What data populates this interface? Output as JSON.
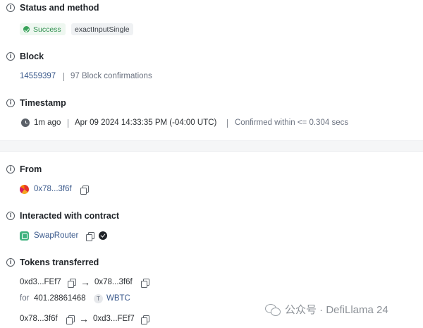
{
  "status_section": {
    "label": "Status and method",
    "status": "Success",
    "method": "exactInputSingle"
  },
  "block_section": {
    "label": "Block",
    "number": "14559397",
    "confirmations": "97 Block confirmations"
  },
  "timestamp_section": {
    "label": "Timestamp",
    "relative": "1m ago",
    "absolute": "Apr 09 2024 14:33:35 PM (-04:00 UTC)",
    "confirmed": "Confirmed within <= 0.304 secs"
  },
  "from_section": {
    "label": "From",
    "address": "0x78...3f6f"
  },
  "contract_section": {
    "label": "Interacted with contract",
    "name": "SwapRouter"
  },
  "tokens_section": {
    "label": "Tokens transferred",
    "transfers": [
      {
        "from": "0xd3...FEf7",
        "to": "0x78...3f6f",
        "for_label": "for",
        "amount": "401.28861468",
        "token_letter": "T",
        "token": "WBTC"
      },
      {
        "from": "0x78...3f6f",
        "to": "0xd3...FEf7"
      }
    ]
  },
  "watermark": {
    "text": "公众号 · DefiLlama 24"
  },
  "icons": {
    "info": "info-icon",
    "clock": "clock-icon",
    "copy": "copy-icon",
    "arrow": "arrow-right-icon",
    "verified": "verified-check-icon"
  },
  "colors": {
    "success": "#2f8f4e",
    "link": "#3b5a8c",
    "muted": "#6b7280"
  }
}
